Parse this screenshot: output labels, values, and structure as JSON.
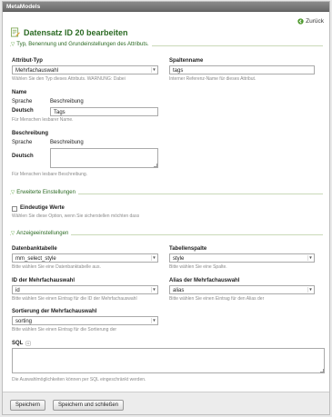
{
  "app_title": "MetaModels",
  "back_label": "Zurück",
  "page_heading": "Datensatz ID 20 bearbeiten",
  "sections": {
    "type_name": "Typ, Benennung und Grundeinstellungen des Attributs.",
    "extended": "Erweiterte Einstellungen",
    "display": "Anzeigeeinstellungen"
  },
  "fields": {
    "attribute_type": {
      "label": "Attribut-Typ",
      "value": "Mehrfachauswahl",
      "help": "Wählen Sie den Typ dieses Attributs. WARNUNG: Dabei"
    },
    "column_name": {
      "label": "Spaltenname",
      "value": "tags",
      "help": "Interner Referenz-Name für dieses Attribut."
    },
    "name": {
      "label": "Name",
      "col_language": "Sprache",
      "col_description": "Beschreibung",
      "language": "Deutsch",
      "value": "Tags",
      "help": "Für Menschen lesbarer Name."
    },
    "description": {
      "label": "Beschreibung",
      "col_language": "Sprache",
      "col_description": "Beschreibung",
      "language": "Deutsch",
      "value": "",
      "help": "Für Menschen lesbare Beschreibung."
    },
    "unique": {
      "label": "Eindeutige Werte",
      "checked": false,
      "help": "Wählen Sie diese Option, wenn Sie sicherstellen möchten dass"
    },
    "db_table": {
      "label": "Datenbanktabelle",
      "value": "mm_select_style",
      "help": "Bitte wählen Sie eine Datenbanktabelle aus."
    },
    "table_column": {
      "label": "Tabellenspalte",
      "value": "style",
      "help": "Bitte wählen Sie eine Spalte."
    },
    "id_column": {
      "label": "ID der Mehrfachauswahl",
      "value": "id",
      "help": "Bitte wählen Sie einen Eintrag für die ID der Mehrfachauswahl"
    },
    "alias_column": {
      "label": "Alias der Mehrfachauswahl",
      "value": "alias",
      "help": "Bitte wählen Sie einen Eintrag für den Alias der"
    },
    "sorting": {
      "label": "Sortierung der Mehrfachauswahl",
      "value": "sorting",
      "help": "Bitte wählen Sie einen Eintrag für die Sortierung der"
    },
    "sql": {
      "label": "SQL",
      "value": "",
      "help": "Die Auswahlmöglichkeiten können per SQL eingeschränkt werden."
    }
  },
  "buttons": {
    "save": "Speichern",
    "save_close": "Speichern und schließen"
  },
  "colors": {
    "accent_green": "#2b6a23",
    "legend_green": "#56a03a"
  }
}
